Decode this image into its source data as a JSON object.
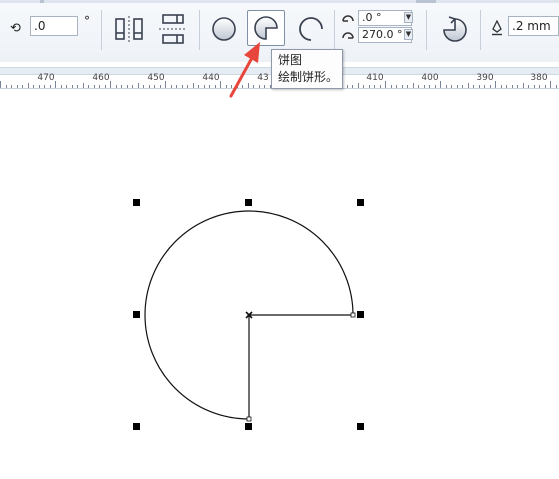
{
  "toolbar": {
    "rotation_icon": "rotate-ccw-icon",
    "rotation_value": ".0",
    "rotation_unit": "°",
    "mirror_horizontal_icon": "mirror-horizontal-icon",
    "mirror_vertical_icon": "mirror-vertical-icon",
    "ellipse_icon": "ellipse-icon",
    "pie_icon": "pie-icon",
    "arc_icon": "arc-icon",
    "start_angle_value": ".0 °",
    "end_angle_value": "270.0 °",
    "direction_icon": "change-direction-icon",
    "outline_width_icon": "outline-pen-icon",
    "outline_width_value": ".2 mm",
    "spin_up": "▲",
    "spin_down": "▼"
  },
  "tooltip": {
    "title": "饼图",
    "description": "绘制饼形。"
  },
  "ruler": {
    "labels": [
      "470",
      "460",
      "450",
      "440",
      "43",
      "410",
      "400",
      "390",
      "380"
    ]
  },
  "canvas": {
    "shape": "pie",
    "start_angle": 0,
    "end_angle": 270
  },
  "colors": {
    "annotation_arrow": "#e8453c",
    "selected_button_border": "#7f8fa6"
  }
}
